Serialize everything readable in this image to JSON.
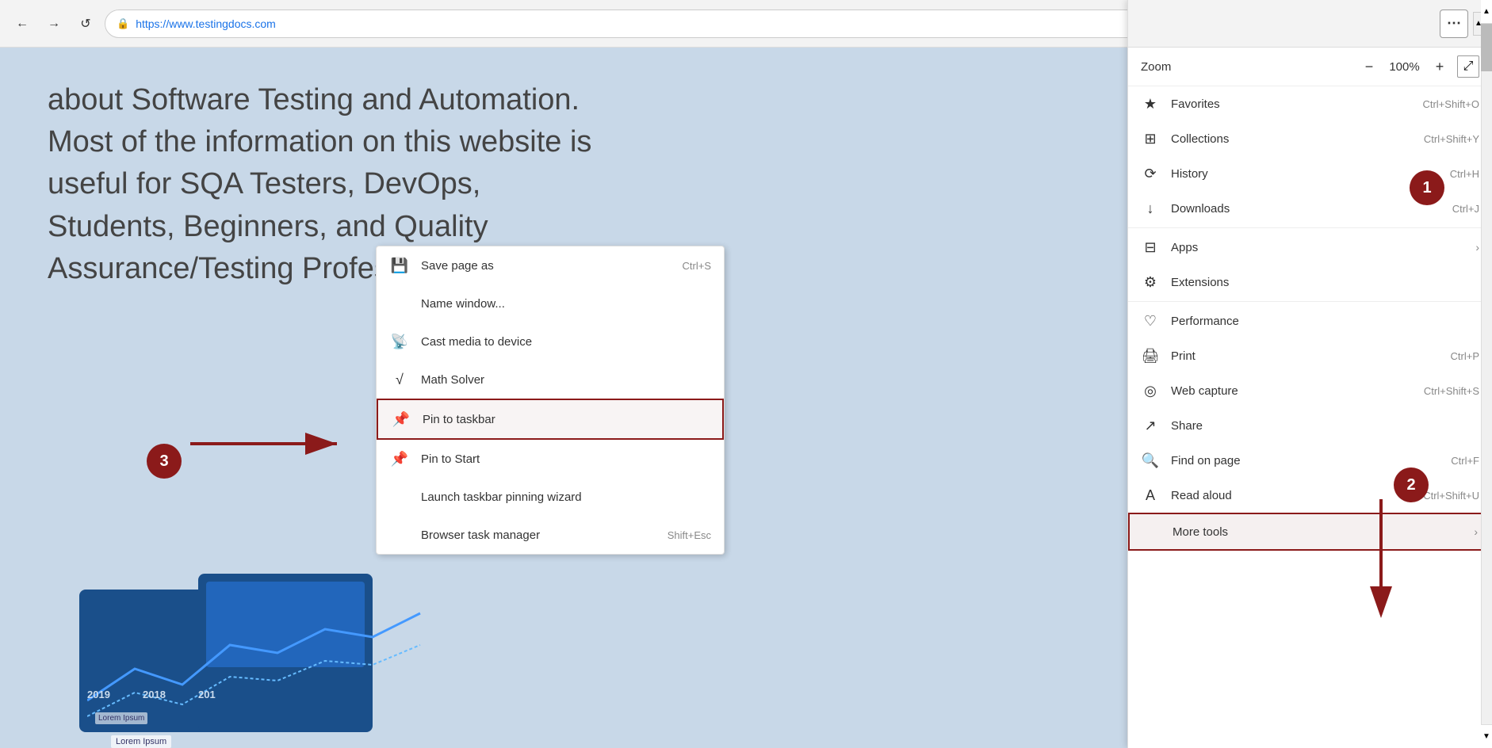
{
  "browser": {
    "back_label": "←",
    "forward_label": "→",
    "refresh_label": "↺",
    "address": "https://www.testingdocs.com",
    "three_dots_label": "⋯"
  },
  "page": {
    "body_text": "about Software Testing and Automation. Most of the information on this website is useful for SQA Testers, DevOps, Students, Beginners, and Quality Assurance/Testing Professionals."
  },
  "edge_menu": {
    "zoom_label": "Zoom",
    "zoom_minus": "−",
    "zoom_value": "100%",
    "zoom_plus": "+",
    "items": [
      {
        "id": "favorites",
        "icon": "★",
        "label": "Favorites",
        "shortcut": "Ctrl+Shift+O",
        "arrow": ""
      },
      {
        "id": "collections",
        "icon": "⊞",
        "label": "Collections",
        "shortcut": "Ctrl+Shift+Y",
        "arrow": ""
      },
      {
        "id": "history",
        "icon": "⟳",
        "label": "History",
        "shortcut": "Ctrl+H",
        "arrow": ""
      },
      {
        "id": "downloads",
        "icon": "↓",
        "label": "Downloads",
        "shortcut": "Ctrl+J",
        "arrow": ""
      },
      {
        "id": "apps",
        "icon": "⊟",
        "label": "Apps",
        "shortcut": "",
        "arrow": "›"
      },
      {
        "id": "extensions",
        "icon": "⚙",
        "label": "Extensions",
        "shortcut": "",
        "arrow": ""
      },
      {
        "id": "performance",
        "icon": "♡",
        "label": "Performance",
        "shortcut": "",
        "arrow": ""
      },
      {
        "id": "print",
        "icon": "🖨",
        "label": "Print",
        "shortcut": "Ctrl+P",
        "arrow": ""
      },
      {
        "id": "web-capture",
        "icon": "◎",
        "label": "Web capture",
        "shortcut": "Ctrl+Shift+S",
        "arrow": ""
      },
      {
        "id": "share",
        "icon": "↗",
        "label": "Share",
        "shortcut": "",
        "arrow": ""
      },
      {
        "id": "find-on-page",
        "icon": "🔍",
        "label": "Find on page",
        "shortcut": "Ctrl+F",
        "arrow": ""
      },
      {
        "id": "read-aloud",
        "icon": "A",
        "label": "Read aloud",
        "shortcut": "Ctrl+Shift+U",
        "arrow": ""
      },
      {
        "id": "more-tools",
        "icon": "",
        "label": "More tools",
        "shortcut": "",
        "arrow": "›",
        "highlighted": true
      }
    ]
  },
  "context_menu": {
    "items": [
      {
        "id": "save-page-as",
        "icon": "💾",
        "label": "Save page as",
        "shortcut": "Ctrl+S"
      },
      {
        "id": "name-window",
        "icon": "",
        "label": "Name window...",
        "shortcut": ""
      },
      {
        "id": "cast-media",
        "icon": "📡",
        "label": "Cast media to device",
        "shortcut": ""
      },
      {
        "id": "math-solver",
        "icon": "√",
        "label": "Math Solver",
        "shortcut": ""
      },
      {
        "id": "pin-taskbar",
        "icon": "📌",
        "label": "Pin to taskbar",
        "shortcut": "",
        "highlighted": true
      },
      {
        "id": "pin-start",
        "icon": "📌",
        "label": "Pin to Start",
        "shortcut": ""
      },
      {
        "id": "launch-wizard",
        "icon": "",
        "label": "Launch taskbar pinning wizard",
        "shortcut": ""
      },
      {
        "id": "browser-task",
        "icon": "",
        "label": "Browser task manager",
        "shortcut": "Shift+Esc"
      }
    ]
  },
  "annotations": {
    "circle1": "1",
    "circle2": "2",
    "circle3": "3"
  }
}
